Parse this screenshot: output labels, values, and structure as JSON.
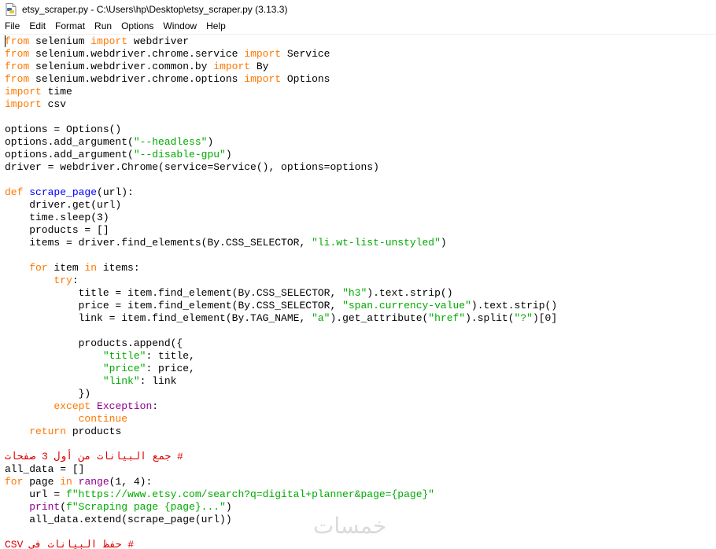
{
  "window": {
    "title": "etsy_scraper.py - C:\\Users\\hp\\Desktop\\etsy_scraper.py (3.13.3)",
    "icon": "python-file-icon"
  },
  "menubar": {
    "items": [
      "File",
      "Edit",
      "Format",
      "Run",
      "Options",
      "Window",
      "Help"
    ]
  },
  "watermark": "خمسات",
  "colors": {
    "keyword": "#ff7700",
    "builtin": "#900090",
    "string": "#00aa00",
    "comment": "#dd0000",
    "definition": "#0000ff"
  },
  "code_lines": [
    [
      [
        "kw",
        "from"
      ],
      [
        "t",
        " selenium "
      ],
      [
        "kw",
        "import"
      ],
      [
        "t",
        " webdriver"
      ]
    ],
    [
      [
        "kw",
        "from"
      ],
      [
        "t",
        " selenium.webdriver.chrome.service "
      ],
      [
        "kw",
        "import"
      ],
      [
        "t",
        " Service"
      ]
    ],
    [
      [
        "kw",
        "from"
      ],
      [
        "t",
        " selenium.webdriver.common.by "
      ],
      [
        "kw",
        "import"
      ],
      [
        "t",
        " By"
      ]
    ],
    [
      [
        "kw",
        "from"
      ],
      [
        "t",
        " selenium.webdriver.chrome.options "
      ],
      [
        "kw",
        "import"
      ],
      [
        "t",
        " Options"
      ]
    ],
    [
      [
        "kw",
        "import"
      ],
      [
        "t",
        " time"
      ]
    ],
    [
      [
        "kw",
        "import"
      ],
      [
        "t",
        " csv"
      ]
    ],
    [],
    [
      [
        "t",
        "options = Options()"
      ]
    ],
    [
      [
        "t",
        "options.add_argument("
      ],
      [
        "str",
        "\"--headless\""
      ],
      [
        "t",
        ")"
      ]
    ],
    [
      [
        "t",
        "options.add_argument("
      ],
      [
        "str",
        "\"--disable-gpu\""
      ],
      [
        "t",
        ")"
      ]
    ],
    [
      [
        "t",
        "driver = webdriver.Chrome(service=Service(), options=options)"
      ]
    ],
    [],
    [
      [
        "kw",
        "def"
      ],
      [
        "t",
        " "
      ],
      [
        "def",
        "scrape_page"
      ],
      [
        "t",
        "(url):"
      ]
    ],
    [
      [
        "t",
        "    driver.get(url)"
      ]
    ],
    [
      [
        "t",
        "    time.sleep(3)"
      ]
    ],
    [
      [
        "t",
        "    products = []"
      ]
    ],
    [
      [
        "t",
        "    items = driver.find_elements(By.CSS_SELECTOR, "
      ],
      [
        "str",
        "\"li.wt-list-unstyled\""
      ],
      [
        "t",
        ")"
      ]
    ],
    [],
    [
      [
        "t",
        "    "
      ],
      [
        "kw",
        "for"
      ],
      [
        "t",
        " item "
      ],
      [
        "kw",
        "in"
      ],
      [
        "t",
        " items:"
      ]
    ],
    [
      [
        "t",
        "        "
      ],
      [
        "kw",
        "try"
      ],
      [
        "t",
        ":"
      ]
    ],
    [
      [
        "t",
        "            title = item.find_element(By.CSS_SELECTOR, "
      ],
      [
        "str",
        "\"h3\""
      ],
      [
        "t",
        ").text.strip()"
      ]
    ],
    [
      [
        "t",
        "            price = item.find_element(By.CSS_SELECTOR, "
      ],
      [
        "str",
        "\"span.currency-value\""
      ],
      [
        "t",
        ").text.strip()"
      ]
    ],
    [
      [
        "t",
        "            link = item.find_element(By.TAG_NAME, "
      ],
      [
        "str",
        "\"a\""
      ],
      [
        "t",
        ").get_attribute("
      ],
      [
        "str",
        "\"href\""
      ],
      [
        "t",
        ").split("
      ],
      [
        "str",
        "\"?\""
      ],
      [
        "t",
        ")[0]"
      ]
    ],
    [],
    [
      [
        "t",
        "            products.append({"
      ]
    ],
    [
      [
        "t",
        "                "
      ],
      [
        "str",
        "\"title\""
      ],
      [
        "t",
        ": title,"
      ]
    ],
    [
      [
        "t",
        "                "
      ],
      [
        "str",
        "\"price\""
      ],
      [
        "t",
        ": price,"
      ]
    ],
    [
      [
        "t",
        "                "
      ],
      [
        "str",
        "\"link\""
      ],
      [
        "t",
        ": link"
      ]
    ],
    [
      [
        "t",
        "            })"
      ]
    ],
    [
      [
        "t",
        "        "
      ],
      [
        "kw",
        "except"
      ],
      [
        "t",
        " "
      ],
      [
        "bi",
        "Exception"
      ],
      [
        "t",
        ":"
      ]
    ],
    [
      [
        "t",
        "            "
      ],
      [
        "kw",
        "continue"
      ]
    ],
    [
      [
        "t",
        "    "
      ],
      [
        "kw",
        "return"
      ],
      [
        "t",
        " products"
      ]
    ],
    [],
    [
      [
        "cmt",
        "# جمع البيانات من أول 3 صفحات"
      ]
    ],
    [
      [
        "t",
        "all_data = []"
      ]
    ],
    [
      [
        "kw",
        "for"
      ],
      [
        "t",
        " page "
      ],
      [
        "kw",
        "in"
      ],
      [
        "t",
        " "
      ],
      [
        "bi",
        "range"
      ],
      [
        "t",
        "(1, 4):"
      ]
    ],
    [
      [
        "t",
        "    url = "
      ],
      [
        "str",
        "f\"https://www.etsy.com/search?q=digital+planner&page={page}\""
      ]
    ],
    [
      [
        "t",
        "    "
      ],
      [
        "bi",
        "print"
      ],
      [
        "t",
        "("
      ],
      [
        "str",
        "f\"Scraping page {page}...\""
      ],
      [
        "t",
        ")"
      ]
    ],
    [
      [
        "t",
        "    all_data.extend(scrape_page(url))"
      ]
    ],
    [],
    [
      [
        "cmt",
        "# حفظ البيانات في CSV"
      ]
    ]
  ]
}
